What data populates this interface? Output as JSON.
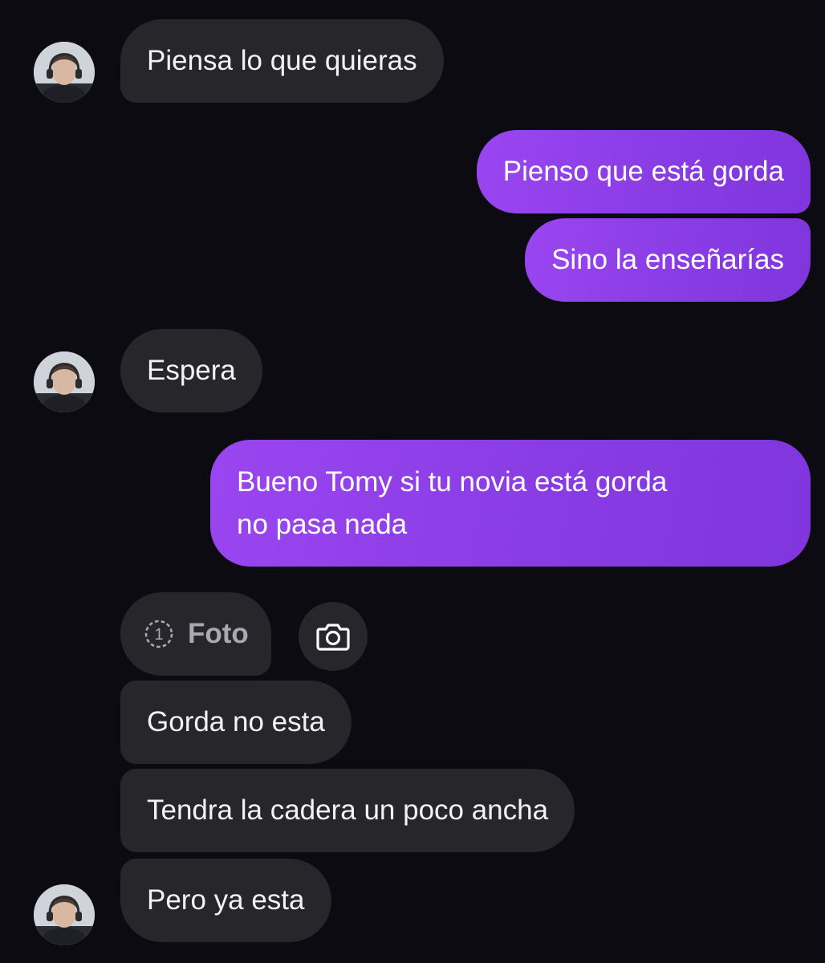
{
  "conversation": {
    "messages": [
      {
        "from": "them",
        "text": "Piensa lo que quieras"
      },
      {
        "from": "me",
        "text": "Pienso que está gorda"
      },
      {
        "from": "me",
        "text": "Sino la enseñarías"
      },
      {
        "from": "them",
        "text": "Espera"
      },
      {
        "from": "me",
        "lines": [
          "Bueno Tomy si tu novia está gorda",
          "no pasa nada"
        ]
      },
      {
        "from": "them",
        "attachment": {
          "count": "1",
          "label": "Foto",
          "icon": "view-once-icon"
        }
      },
      {
        "from": "them",
        "text": "Gorda no esta"
      },
      {
        "from": "them",
        "text": "Tendra la cadera un poco ancha"
      },
      {
        "from": "them",
        "text": "Pero ya esta"
      }
    ],
    "camera_button": {
      "icon": "camera-icon"
    }
  },
  "colors": {
    "background": "#0b0b11",
    "received_bubble": "#26262b",
    "sent_bubble": "#8a3ce4",
    "text": "#f3f3f6",
    "muted_text": "#a9a9b0"
  }
}
